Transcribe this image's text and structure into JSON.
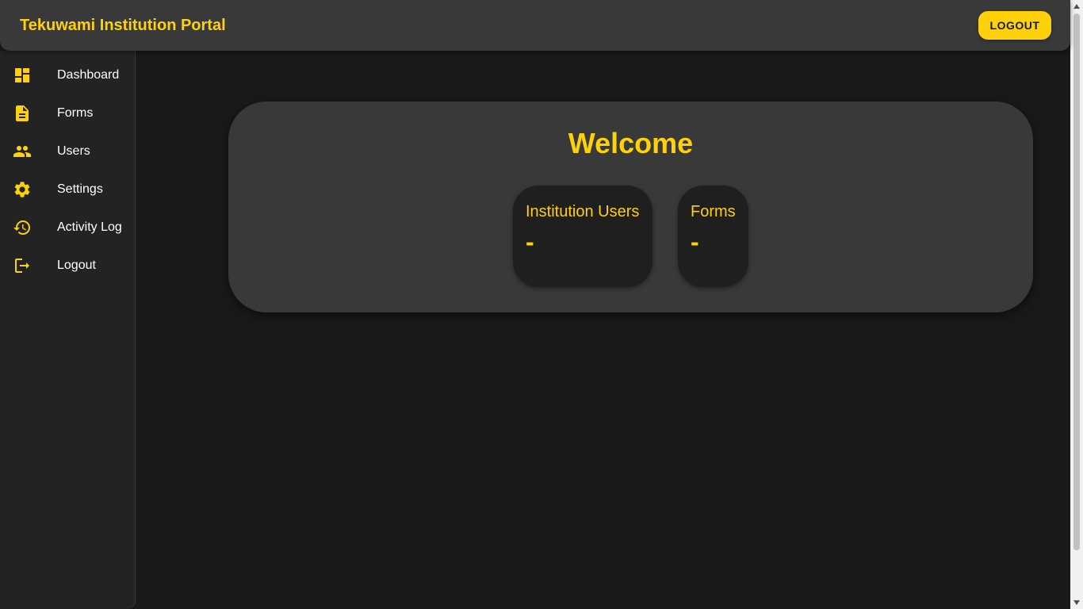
{
  "header": {
    "title": "Tekuwami Institution Portal",
    "logout_label": "LOGOUT"
  },
  "sidebar": {
    "items": [
      {
        "label": "Dashboard",
        "icon": "dashboard-icon"
      },
      {
        "label": "Forms",
        "icon": "document-icon"
      },
      {
        "label": "Users",
        "icon": "people-icon"
      },
      {
        "label": "Settings",
        "icon": "gear-icon"
      },
      {
        "label": "Activity Log",
        "icon": "history-icon"
      },
      {
        "label": "Logout",
        "icon": "logout-icon"
      }
    ]
  },
  "main": {
    "welcome_title": "Welcome",
    "stats": [
      {
        "label": "Institution Users",
        "value": "-"
      },
      {
        "label": "Forms",
        "value": "-"
      }
    ]
  },
  "colors": {
    "accent": "#ffd10a",
    "background": "#191919",
    "surface": "#393939",
    "sidebar": "#232323",
    "stat_card": "#1f1f1f"
  }
}
